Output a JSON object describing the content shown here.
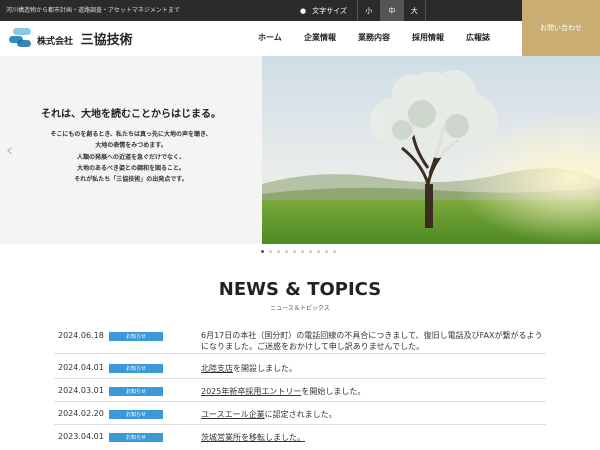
{
  "topbar": {
    "tagline": "河川構造物から都市計画・道路調査・アセットマネジメントまで",
    "font_size_label": "文字サイズ",
    "font_sizes": [
      "小",
      "中",
      "大"
    ],
    "active_font_size": "中"
  },
  "contact": {
    "label": "お問い合わせ"
  },
  "logo": {
    "prefix": "株式会社",
    "name": "三協技術"
  },
  "nav": {
    "items": [
      "ホーム",
      "企業情報",
      "業務内容",
      "採用情報",
      "広報誌"
    ]
  },
  "hero": {
    "title": "それは、大地を読むことからはじまる。",
    "lines": [
      "そこにものを創るとき、私たちは真っ先に大地の声を聴き、",
      "大地の表情をみつめます。",
      "人類の発展への近道を急ぐだけでなく、",
      "大地のあるべき姿との調和を図ること。",
      "それが私たち「三協技術」の出発点です。"
    ],
    "prev_icon": "chevron-left-icon",
    "next_icon": "chevron-right-icon",
    "slide_count": 10,
    "active_slide": 1
  },
  "news": {
    "title": "NEWS & TOPICS",
    "subtitle": "ニュース＆トピックス",
    "items": [
      {
        "date": "2024.06.18",
        "badge": "お知らせ",
        "link": "",
        "text": "6月17日の本社（国分町）の電話回線の不具合につきまして、復旧し電話及びFAXが繋がるようになりました。ご迷惑をおかけして申し訳ありませんでした。"
      },
      {
        "date": "2024.04.01",
        "badge": "お知らせ",
        "link": "北陸支店",
        "text": "を開設しました。"
      },
      {
        "date": "2024.03.01",
        "badge": "お知らせ",
        "link": "2025年新卒採用エントリー",
        "text": "を開始しました。"
      },
      {
        "date": "2024.02.20",
        "badge": "お知らせ",
        "link": "ユースエール企業",
        "text": "に認定されました。"
      },
      {
        "date": "2023.04.01",
        "badge": "お知らせ",
        "link": "茨城営業所を移転しました。",
        "text": ""
      }
    ]
  },
  "colors": {
    "accent_gold": "#c9ad72",
    "badge_blue": "#3a9ad9",
    "topbar": "#2b2b2b"
  }
}
